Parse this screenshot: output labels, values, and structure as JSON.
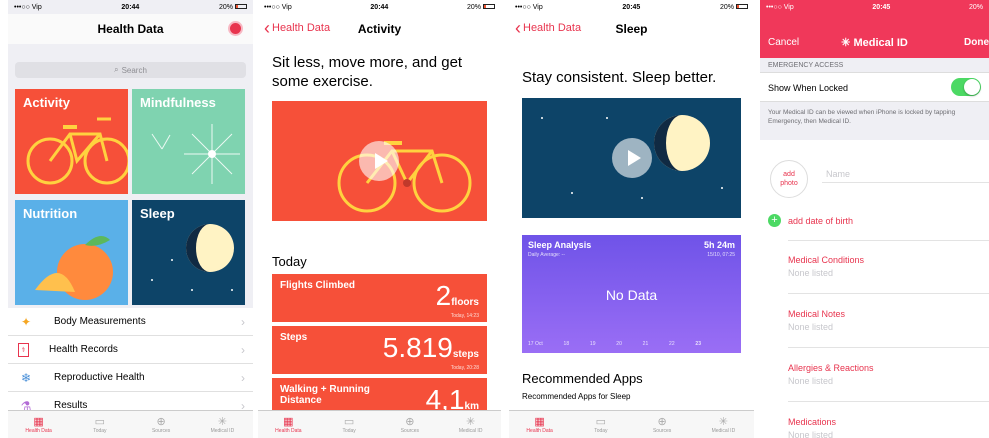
{
  "screen1": {
    "status": {
      "carrier": "•••○○ Vip",
      "time": "20:44",
      "battery": "20%"
    },
    "title": "Health Data",
    "search_placeholder": "Search",
    "tiles": [
      "Activity",
      "Mindfulness",
      "Nutrition",
      "Sleep"
    ],
    "rows": [
      {
        "label": "Body Measurements",
        "icon": "figure-icon"
      },
      {
        "label": "Health Records",
        "icon": "records-icon"
      },
      {
        "label": "Reproductive Health",
        "icon": "snowflake-icon"
      },
      {
        "label": "Results",
        "icon": "flask-icon"
      }
    ]
  },
  "screen2": {
    "status": {
      "carrier": "•••○○ Vip",
      "time": "20:44",
      "battery": "20%"
    },
    "back": "Health Data",
    "title": "Activity",
    "headline": "Sit less, move more, and get some exercise.",
    "today": "Today",
    "cards": [
      {
        "label": "Flights Climbed",
        "value": "2",
        "unit": "floors",
        "date": "Today, 14:23"
      },
      {
        "label": "Steps",
        "value": "5.819",
        "unit": "steps",
        "date": "Today, 20:28"
      },
      {
        "label": "Walking + Running Distance",
        "value": "4,1",
        "unit": "km",
        "date": ""
      }
    ]
  },
  "screen3": {
    "status": {
      "carrier": "•••○○ Vip",
      "time": "20:45",
      "battery": "20%"
    },
    "back": "Health Data",
    "title": "Sleep",
    "headline": "Stay consistent. Sleep better.",
    "analysis": {
      "title": "Sleep Analysis",
      "value": "5h 24m",
      "subtitle": "Daily Average: --",
      "date": "15/10, 07:25",
      "nodata": "No Data",
      "days": [
        "17 Oct",
        "18",
        "19",
        "20",
        "21",
        "22",
        "23"
      ]
    },
    "rec_title": "Recommended Apps",
    "rec_sub": "Recommended Apps for Sleep"
  },
  "screen4": {
    "status": {
      "carrier": "•••○○ Vip",
      "time": "20:45",
      "battery": "20%"
    },
    "cancel": "Cancel",
    "title": "Medical ID",
    "done": "Done",
    "section": "EMERGENCY ACCESS",
    "show_locked": "Show When Locked",
    "note": "Your Medical ID can be viewed when iPhone is locked by tapping Emergency, then Medical ID.",
    "add_photo": "add photo",
    "name_placeholder": "Name",
    "add_dob": "add date of birth",
    "fields": [
      {
        "label": "Medical Conditions",
        "value": "None listed"
      },
      {
        "label": "Medical Notes",
        "value": "None listed"
      },
      {
        "label": "Allergies & Reactions",
        "value": "None listed"
      },
      {
        "label": "Medications",
        "value": "None listed"
      }
    ]
  },
  "tabs": [
    "Health Data",
    "Today",
    "Sources",
    "Medical ID"
  ],
  "colors": {
    "accent": "#e8344e",
    "activity": "#f65039",
    "mind": "#7fd3b0",
    "nutrition": "#5ab0e8",
    "sleep": "#0d4468",
    "sleepcard": "#7b5cf0"
  }
}
